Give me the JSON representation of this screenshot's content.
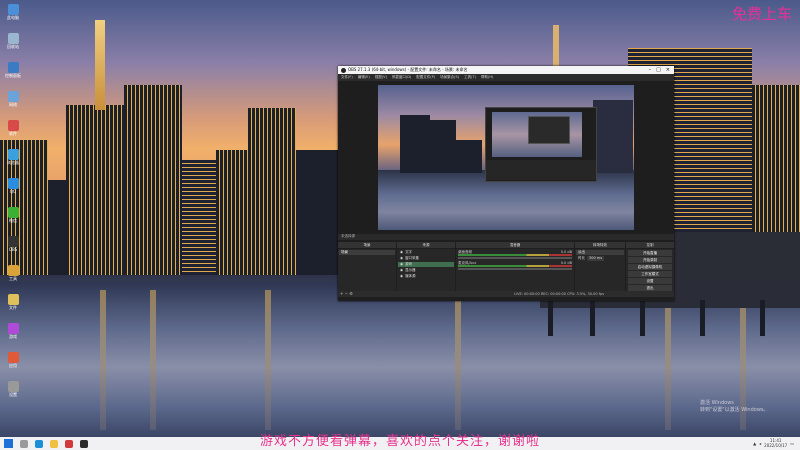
{
  "watermark_top": "免费上车",
  "subtitle": "游戏不方便看弹幕，喜欢的点个关注，谢谢啦",
  "activate_windows": [
    "激活 Windows",
    "转到\"设置\"以激活 Windows。"
  ],
  "desktop_icons": [
    {
      "label": "此电脑",
      "color": "#4a8fd8"
    },
    {
      "label": "回收站",
      "color": "#9bb6cf"
    },
    {
      "label": "控制面板",
      "color": "#3b7bc4"
    },
    {
      "label": "网络",
      "color": "#6aa3d9"
    },
    {
      "label": "软件",
      "color": "#d84a4a"
    },
    {
      "label": "浏览器",
      "color": "#3aa0e0"
    },
    {
      "label": "QQ",
      "color": "#2a8de0"
    },
    {
      "label": "微信",
      "color": "#3cb034"
    },
    {
      "label": "OBS",
      "color": "#333333"
    },
    {
      "label": "工具",
      "color": "#d9a23a"
    },
    {
      "label": "文件",
      "color": "#e0c05a"
    },
    {
      "label": "游戏",
      "color": "#b04ad8"
    },
    {
      "label": "应用",
      "color": "#e05a3a"
    },
    {
      "label": "设置",
      "color": "#999999"
    }
  ],
  "taskbar": {
    "apps": [
      {
        "name": "search",
        "color": "#9a9a9a"
      },
      {
        "name": "edge",
        "color": "#1d8fd6"
      },
      {
        "name": "explorer",
        "color": "#f0c040"
      },
      {
        "name": "app-red",
        "color": "#d23b3b"
      },
      {
        "name": "obs",
        "color": "#2b2b2b"
      }
    ],
    "time": "11:41",
    "date": "2022/10/17"
  },
  "obs": {
    "title": "OBS 27.1.3 (64-bit, windows) - 配置文件: 未命名 - 场景: 未命名",
    "menu": [
      "文件(F)",
      "编辑(E)",
      "视图(V)",
      "停靠窗口(D)",
      "配置文件(P)",
      "场景集合(S)",
      "工具(T)",
      "帮助(H)"
    ],
    "status_line": "未选择源",
    "docks": {
      "scenes": "场景",
      "sources": "来源",
      "mixer": "混音器",
      "transitions": "转场特效",
      "controls": "控制"
    },
    "scenes": [
      "场景"
    ],
    "sources": [
      "文字",
      "窗口采集",
      "游戏",
      "显示器",
      "媒体源"
    ],
    "mixer": [
      {
        "name": "桌面音频",
        "db": "0.0 dB"
      },
      {
        "name": "麦克风/Aux",
        "db": "0.0 dB"
      }
    ],
    "transition": {
      "type": "淡出",
      "duration_label": "时长",
      "duration": "300 ms"
    },
    "controls": [
      "开始直播",
      "开始录制",
      "启动虚拟摄像机",
      "工作室模式",
      "设置",
      "退出"
    ],
    "statusbar": "LIVE: 00:00:00  REC: 00:00:00  CPU: 3.5%, 30.00 fps"
  }
}
